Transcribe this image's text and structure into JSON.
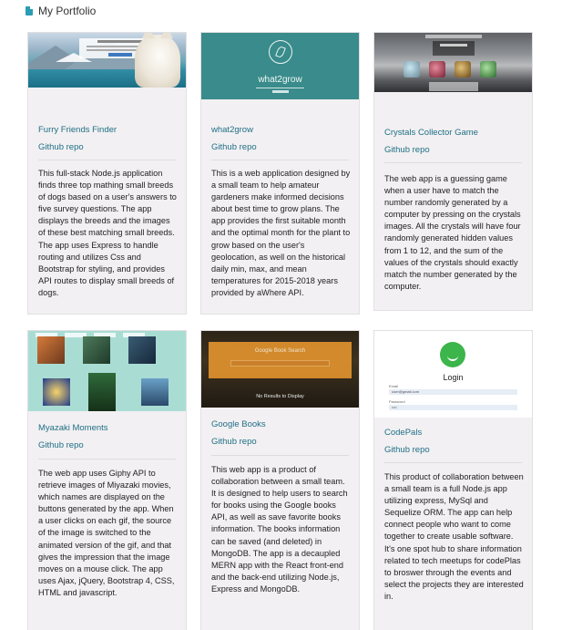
{
  "header": {
    "icon": "document-icon",
    "title": "My Portfolio"
  },
  "projects": [
    {
      "title": "Furry Friends Finder",
      "repo_label": "Github repo",
      "description": "This full-stack Node.js application finds three top mathing small breeds of dogs based on a user's answers to five survey questions. The app displays the breeds and the images of these best matching small breeds. The app uses Express to handle routing and utilizes Css and Bootstrap for styling, and provides API routes to display small breeds of dogs."
    },
    {
      "title": "what2grow",
      "repo_label": "Github repo",
      "thumb_text": "what2grow",
      "description": "This is a web application designed by a small team to help amateur gardeners make informed decisions about best time to grow plans. The app provides the first suitable month and the optimal month for the plant to grow based on the user's geolocation, as well on the historical daily min, max, and mean temperatures for 2015-2018 years provided by aWhere API."
    },
    {
      "title": "Crystals Collector Game",
      "repo_label": "Github repo",
      "description": "The web app is a guessing game when a user have to match the number randomly generated by a computer by pressing on the crystals images. All the crystals will have four randomly generated hidden values from 1 to 12, and the sum of the values of the crystals should exactly match the number generated by the computer."
    },
    {
      "title": "Myazaki Moments",
      "repo_label": "Github repo",
      "description": "The web app uses Giphy API to retrieve images of Miyazaki movies, which names are displayed on the buttons generated by the app. When a user clicks on each gif, the source of the image is switched to the animated version of the gif, and that gives the impression that the image moves on a mouse click. The app uses Ajax, jQuery, Bootstrap 4, CSS, HTML and javascript."
    },
    {
      "title": "Google Books",
      "repo_label": "Github repo",
      "thumb_text": "Google Book Search",
      "thumb_footer": "No Results to Display",
      "description": "This web app is a product of collaboration between a small team. It is designed to help users to search for books using the Google books API, as well as save favorite books information. The books information can be saved (and deleted) in MongoDB. The app is a decaupled MERN app with the React front-end and the back-end utilizing Node.js, Express and MongoDB."
    },
    {
      "title": "CodePals",
      "repo_label": "Github repo",
      "thumb_text": "Login",
      "thumb_email_label": "Email",
      "thumb_email_value": "user@gmail.com",
      "thumb_password_label": "Password",
      "thumb_password_value": "••••",
      "description": "This product of collaboration between a small team is a full Node.js app utilizing express, MySql and Sequelize ORM. The app can help connect people who want to come together to create usable software. It's one spot hub to share information related to tech meetups for codePlas to broswer through the events and select the projects they are interested in."
    }
  ],
  "colors": {
    "link": "#1f6f86",
    "card_bg": "#f2f0f2",
    "accent_teal": "#3a8b8b",
    "accent_orange": "#e0922e",
    "accent_green": "#3cb54a"
  }
}
